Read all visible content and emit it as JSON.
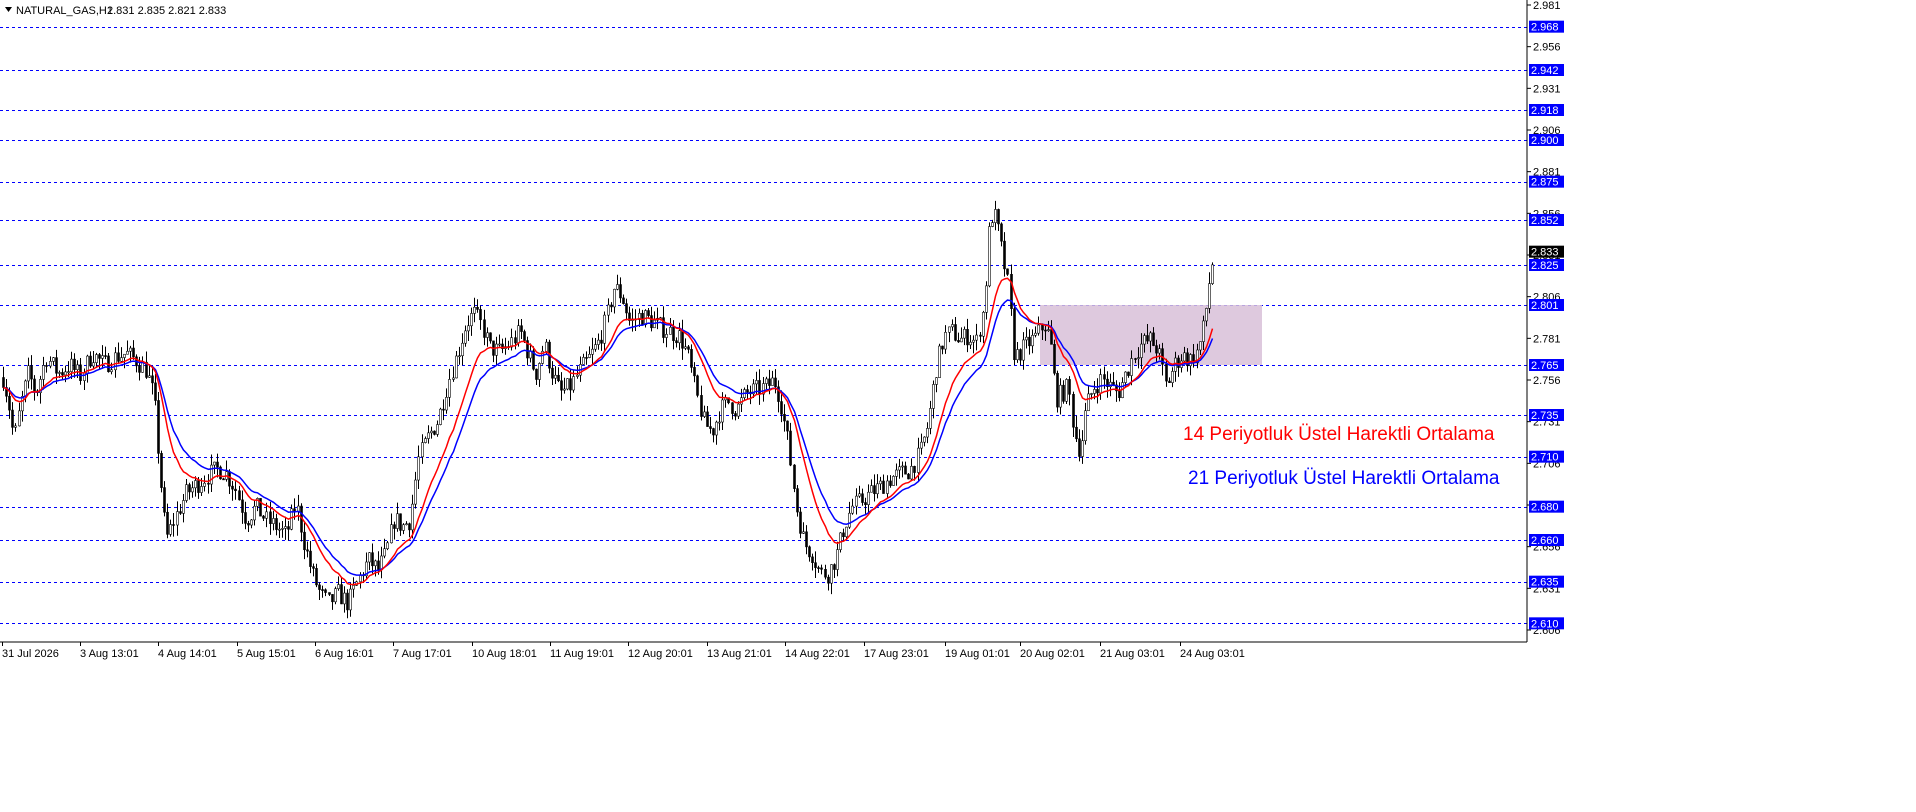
{
  "header": {
    "symbol": "NATURAL_GAS,H1",
    "ohlc": "2.831 2.835 2.821 2.833"
  },
  "annotations": {
    "ema14": "14 Periyotluk Üstel Harektli Ortalama",
    "ema21": "21  Periyotluk Üstel Harektli Ortalama"
  },
  "colors": {
    "bull_candle": "#000000",
    "ema14": "#ff0000",
    "ema21": "#0000ff",
    "level_line": "#0000ff",
    "zone_fill": "#d8bfd8",
    "last_price_bg": "#000000"
  },
  "chart_data": {
    "type": "candlestick",
    "symbol": "NATURAL_GAS",
    "timeframe": "H1",
    "ylim": [
      2.6,
      2.985
    ],
    "y_ticks": [
      2.981,
      2.956,
      2.931,
      2.906,
      2.881,
      2.856,
      2.831,
      2.806,
      2.781,
      2.756,
      2.731,
      2.706,
      2.681,
      2.656,
      2.631,
      2.606
    ],
    "x_ticks": [
      "31 Jul 2026",
      "3 Aug 13:01",
      "4 Aug 14:01",
      "5 Aug 15:01",
      "6 Aug 16:01",
      "7 Aug 17:01",
      "10 Aug 18:01",
      "11 Aug 19:01",
      "12 Aug 20:01",
      "13 Aug 21:01",
      "14 Aug 22:01",
      "17 Aug 23:01",
      "19 Aug 01:01",
      "20 Aug 02:01",
      "21 Aug 03:01",
      "24 Aug 03:01"
    ],
    "horizontal_levels": [
      2.968,
      2.942,
      2.918,
      2.9,
      2.875,
      2.852,
      2.825,
      2.801,
      2.765,
      2.735,
      2.71,
      2.68,
      2.66,
      2.635,
      2.61
    ],
    "last_price": 2.833,
    "zone": {
      "from_label": "20 Aug 02:01",
      "to_label": "24 Aug 03:01",
      "price_low": 2.765,
      "price_high": 2.801
    },
    "price_path": [
      [
        0,
        2.765
      ],
      [
        8,
        2.745
      ],
      [
        14,
        2.72
      ],
      [
        20,
        2.74
      ],
      [
        28,
        2.76
      ],
      [
        36,
        2.748
      ],
      [
        46,
        2.77
      ],
      [
        58,
        2.76
      ],
      [
        70,
        2.765
      ],
      [
        80,
        2.758
      ],
      [
        92,
        2.772
      ],
      [
        104,
        2.765
      ],
      [
        116,
        2.77
      ],
      [
        126,
        2.772
      ],
      [
        136,
        2.768
      ],
      [
        146,
        2.762
      ],
      [
        154,
        2.745
      ],
      [
        160,
        2.7
      ],
      [
        166,
        2.66
      ],
      [
        174,
        2.672
      ],
      [
        186,
        2.688
      ],
      [
        196,
        2.693
      ],
      [
        206,
        2.698
      ],
      [
        218,
        2.703
      ],
      [
        226,
        2.7
      ],
      [
        236,
        2.69
      ],
      [
        246,
        2.672
      ],
      [
        256,
        2.68
      ],
      [
        266,
        2.672
      ],
      [
        276,
        2.668
      ],
      [
        286,
        2.663
      ],
      [
        296,
        2.682
      ],
      [
        304,
        2.658
      ],
      [
        312,
        2.64
      ],
      [
        320,
        2.628
      ],
      [
        328,
        2.622
      ],
      [
        338,
        2.628
      ],
      [
        348,
        2.622
      ],
      [
        358,
        2.636
      ],
      [
        368,
        2.648
      ],
      [
        378,
        2.642
      ],
      [
        386,
        2.652
      ],
      [
        394,
        2.673
      ],
      [
        402,
        2.668
      ],
      [
        410,
        2.672
      ],
      [
        418,
        2.708
      ],
      [
        428,
        2.722
      ],
      [
        438,
        2.732
      ],
      [
        448,
        2.755
      ],
      [
        458,
        2.773
      ],
      [
        466,
        2.79
      ],
      [
        474,
        2.796
      ],
      [
        482,
        2.788
      ],
      [
        490,
        2.775
      ],
      [
        500,
        2.773
      ],
      [
        510,
        2.778
      ],
      [
        520,
        2.785
      ],
      [
        528,
        2.772
      ],
      [
        536,
        2.76
      ],
      [
        544,
        2.778
      ],
      [
        552,
        2.76
      ],
      [
        560,
        2.748
      ],
      [
        570,
        2.752
      ],
      [
        580,
        2.762
      ],
      [
        590,
        2.77
      ],
      [
        598,
        2.778
      ],
      [
        606,
        2.792
      ],
      [
        614,
        2.812
      ],
      [
        622,
        2.806
      ],
      [
        630,
        2.79
      ],
      [
        640,
        2.795
      ],
      [
        650,
        2.792
      ],
      [
        660,
        2.788
      ],
      [
        670,
        2.785
      ],
      [
        680,
        2.782
      ],
      [
        688,
        2.77
      ],
      [
        696,
        2.748
      ],
      [
        704,
        2.73
      ],
      [
        712,
        2.725
      ],
      [
        720,
        2.738
      ],
      [
        728,
        2.743
      ],
      [
        736,
        2.738
      ],
      [
        746,
        2.748
      ],
      [
        756,
        2.75
      ],
      [
        766,
        2.752
      ],
      [
        774,
        2.756
      ],
      [
        780,
        2.745
      ],
      [
        788,
        2.718
      ],
      [
        796,
        2.68
      ],
      [
        804,
        2.658
      ],
      [
        812,
        2.652
      ],
      [
        820,
        2.64
      ],
      [
        828,
        2.64
      ],
      [
        836,
        2.65
      ],
      [
        844,
        2.668
      ],
      [
        852,
        2.68
      ],
      [
        860,
        2.683
      ],
      [
        870,
        2.688
      ],
      [
        880,
        2.692
      ],
      [
        890,
        2.697
      ],
      [
        900,
        2.7
      ],
      [
        910,
        2.702
      ],
      [
        920,
        2.712
      ],
      [
        928,
        2.73
      ],
      [
        936,
        2.763
      ],
      [
        944,
        2.782
      ],
      [
        952,
        2.785
      ],
      [
        960,
        2.78
      ],
      [
        968,
        2.783
      ],
      [
        976,
        2.778
      ],
      [
        984,
        2.8
      ],
      [
        990,
        2.855
      ],
      [
        996,
        2.853
      ],
      [
        1002,
        2.832
      ],
      [
        1008,
        2.812
      ],
      [
        1014,
        2.77
      ],
      [
        1020,
        2.773
      ],
      [
        1028,
        2.778
      ],
      [
        1036,
        2.782
      ],
      [
        1044,
        2.79
      ],
      [
        1050,
        2.78
      ],
      [
        1056,
        2.745
      ],
      [
        1062,
        2.748
      ],
      [
        1068,
        2.752
      ],
      [
        1074,
        2.725
      ],
      [
        1080,
        2.713
      ],
      [
        1086,
        2.74
      ],
      [
        1094,
        2.752
      ],
      [
        1102,
        2.757
      ],
      [
        1110,
        2.752
      ],
      [
        1118,
        2.748
      ],
      [
        1126,
        2.76
      ],
      [
        1134,
        2.772
      ],
      [
        1142,
        2.778
      ],
      [
        1150,
        2.78
      ],
      [
        1158,
        2.774
      ],
      [
        1166,
        2.752
      ],
      [
        1174,
        2.765
      ],
      [
        1182,
        2.771
      ],
      [
        1190,
        2.768
      ],
      [
        1198,
        2.774
      ],
      [
        1204,
        2.79
      ],
      [
        1210,
        2.82
      ],
      [
        1214,
        2.833
      ]
    ]
  }
}
